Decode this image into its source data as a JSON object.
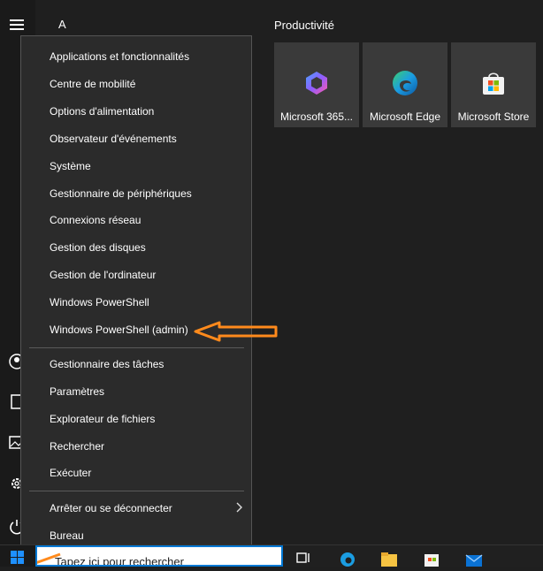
{
  "start": {
    "letter_header": "A",
    "group_title": "Productivité",
    "tiles": [
      {
        "label": "Microsoft 365...",
        "icon": "microsoft-365-icon"
      },
      {
        "label": "Microsoft Edge",
        "icon": "edge-icon"
      },
      {
        "label": "Microsoft Store",
        "icon": "store-icon"
      }
    ],
    "rail_icons": [
      "hamburger-icon",
      "user-icon",
      "documents-icon",
      "pictures-icon",
      "settings-icon",
      "power-icon"
    ]
  },
  "menu": {
    "items": [
      {
        "label": "Applications et fonctionnalités"
      },
      {
        "label": "Centre de mobilité"
      },
      {
        "label": "Options d'alimentation"
      },
      {
        "label": "Observateur d'événements"
      },
      {
        "label": "Système"
      },
      {
        "label": "Gestionnaire de périphériques"
      },
      {
        "label": "Connexions réseau"
      },
      {
        "label": "Gestion des disques"
      },
      {
        "label": "Gestion de l'ordinateur"
      },
      {
        "label": "Windows PowerShell"
      },
      {
        "label": "Windows PowerShell (admin)"
      },
      {
        "label": "Gestionnaire des tâches"
      },
      {
        "label": "Paramètres"
      },
      {
        "label": "Explorateur de fichiers"
      },
      {
        "label": "Rechercher"
      },
      {
        "label": "Exécuter"
      },
      {
        "label": "Arrêter ou se déconnecter"
      },
      {
        "label": "Bureau"
      }
    ]
  },
  "taskbar": {
    "search_placeholder": "Tapez ici pour rechercher",
    "icons": [
      "task-view-icon",
      "edge-icon",
      "file-explorer-icon",
      "store-icon",
      "mail-icon"
    ]
  },
  "colors": {
    "annotation_arrow": "#ff8a1c",
    "accent": "#0078d4"
  }
}
